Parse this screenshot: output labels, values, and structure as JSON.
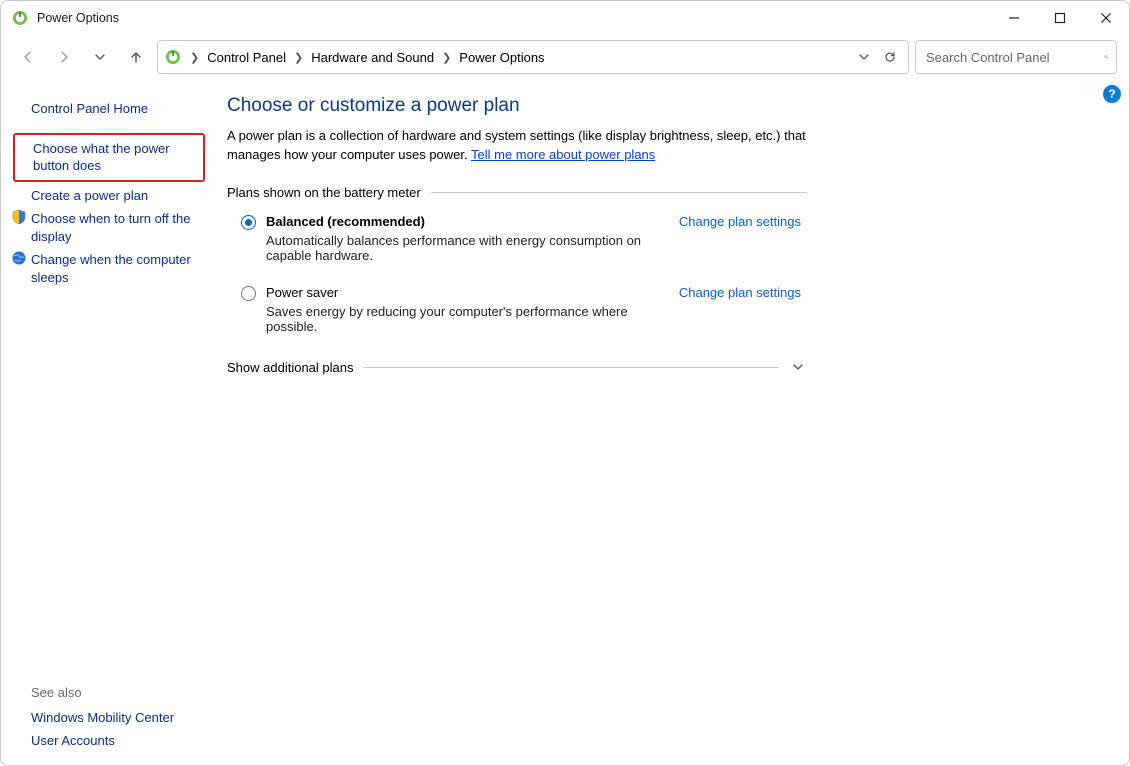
{
  "window": {
    "title": "Power Options"
  },
  "breadcrumbs": {
    "root": "Control Panel",
    "mid": "Hardware and Sound",
    "leaf": "Power Options"
  },
  "search": {
    "placeholder": "Search Control Panel"
  },
  "sidebar": {
    "home": "Control Panel Home",
    "items": [
      "Choose what the power button does",
      "Create a power plan",
      "Choose when to turn off the display",
      "Change when the computer sleeps"
    ],
    "see_also_title": "See also",
    "see_also": [
      "Windows Mobility Center",
      "User Accounts"
    ]
  },
  "main": {
    "title": "Choose or customize a power plan",
    "intro_a": "A power plan is a collection of hardware and system settings (like display brightness, sleep, etc.) that manages how your computer uses power. ",
    "intro_link": "Tell me more about power plans",
    "section_plans_label": "Plans shown on the battery meter",
    "plans": [
      {
        "name": "Balanced (recommended)",
        "desc": "Automatically balances performance with energy consumption on capable hardware.",
        "selected": true,
        "change_label": "Change plan settings"
      },
      {
        "name": "Power saver",
        "desc": "Saves energy by reducing your computer's performance where possible.",
        "selected": false,
        "change_label": "Change plan settings"
      }
    ],
    "additional_label": "Show additional plans",
    "help_badge": "?"
  }
}
